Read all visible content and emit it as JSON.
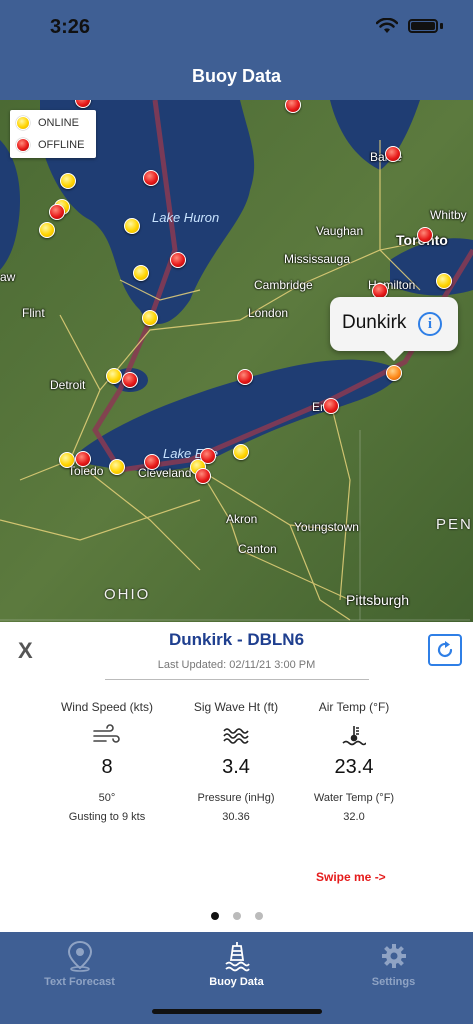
{
  "status": {
    "time": "3:26"
  },
  "nav": {
    "title": "Buoy Data"
  },
  "legend": {
    "online": "ONLINE",
    "offline": "OFFLINE"
  },
  "map": {
    "lakes": [
      "Lake Huron",
      "Lake Erie"
    ],
    "places": [
      "Barrie",
      "Whitby",
      "Vaughan",
      "Toronto",
      "Mississauga",
      "Cambridge",
      "Hamilton",
      "London",
      "Flint",
      "Detroit",
      "Toledo",
      "Cleveland",
      "Erie",
      "Akron",
      "Youngstown",
      "Canton",
      "Pittsburgh",
      "aw"
    ],
    "states": [
      "OHIO",
      "PEN"
    ],
    "callout": {
      "name": "Dunkirk",
      "info_icon": "info-icon"
    },
    "colors": {
      "online": "#ffd400",
      "offline": "#e81a1a",
      "selected": "#ff8a1a"
    }
  },
  "panel": {
    "close_label": "X",
    "title": "Dunkirk - DBLN6",
    "last_updated": "Last Updated: 02/11/21 3:00 PM",
    "metrics": [
      {
        "label": "Wind Speed (kts)",
        "icon": "wind-icon",
        "value": "8"
      },
      {
        "label": "Sig Wave Ht (ft)",
        "icon": "waves-icon",
        "value": "3.4"
      },
      {
        "label": "Air Temp (°F)",
        "icon": "thermometer-icon",
        "value": "23.4"
      }
    ],
    "secondary": [
      {
        "line1": "50°",
        "line2": "Gusting to 9 kts"
      },
      {
        "line1": "Pressure (inHg)",
        "line2": "30.36"
      },
      {
        "line1": "Water Temp (°F)",
        "line2": "32.0"
      }
    ],
    "swipe_hint": "Swipe me ->"
  },
  "tabs": [
    {
      "label": "Text Forecast",
      "icon": "map-pin-icon",
      "active": false
    },
    {
      "label": "Buoy Data",
      "icon": "buoy-icon",
      "active": true
    },
    {
      "label": "Settings",
      "icon": "gear-icon",
      "active": false
    }
  ]
}
